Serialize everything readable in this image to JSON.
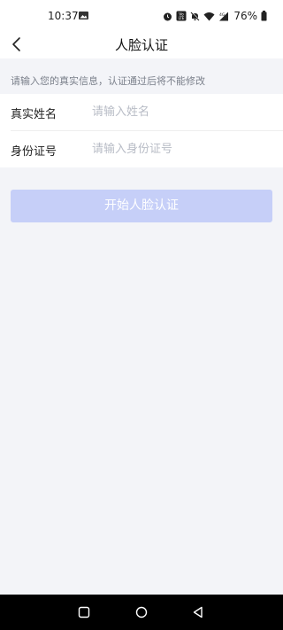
{
  "status_bar": {
    "time": "10:37",
    "battery": "76%",
    "icons": [
      "photo-icon",
      "alarm-icon",
      "volte-icon",
      "mute-icon",
      "wifi-icon",
      "signal-icon",
      "battery-icon"
    ]
  },
  "header": {
    "title": "人脸认证",
    "back_icon": "chevron-left-icon"
  },
  "hint": "请输入您的真实信息，认证通过后将不能修改",
  "form": {
    "name_label": "真实姓名",
    "name_placeholder": "请输入姓名",
    "name_value": "",
    "id_label": "身份证号",
    "id_placeholder": "请输入身份证号",
    "id_value": ""
  },
  "start_button": {
    "label": "开始人脸认证",
    "color": "#c6cff8"
  },
  "nav": {
    "icons": [
      "square-icon",
      "circle-icon",
      "triangle-back-icon"
    ]
  },
  "colors": {
    "background": "#f3f4f8",
    "button_disabled": "#c6cff8",
    "placeholder": "#b8bcc6"
  }
}
